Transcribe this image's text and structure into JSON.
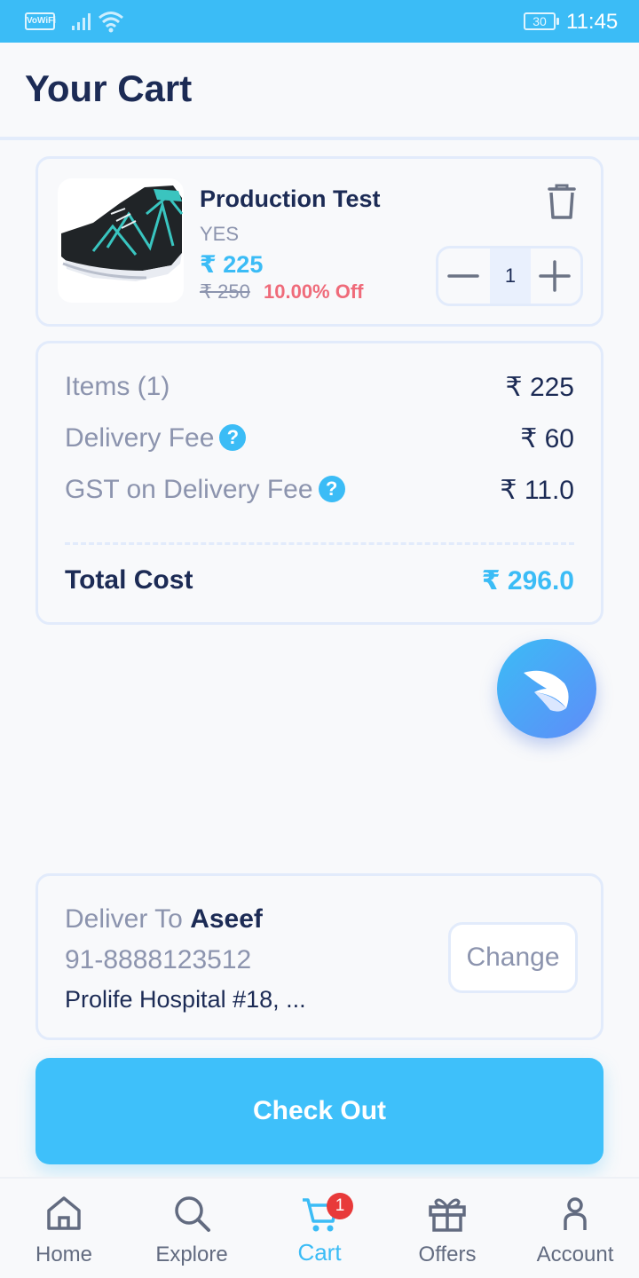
{
  "status_bar": {
    "carrier_badge": "VoWiFi",
    "battery": "30",
    "time": "11:45"
  },
  "header": {
    "title": "Your Cart"
  },
  "cart_item": {
    "name": "Production Test",
    "variant": "YES",
    "price": "₹ 225",
    "original_price": "₹ 250",
    "discount": "10.00% Off",
    "quantity": "1"
  },
  "summary": {
    "rows": [
      {
        "label": "Items (1)",
        "value": "₹ 225",
        "help": false
      },
      {
        "label": "Delivery Fee",
        "value": "₹ 60",
        "help": true
      },
      {
        "label": "GST on Delivery Fee",
        "value": "₹ 11.0",
        "help": true
      }
    ],
    "help_glyph": "?",
    "total_label": "Total Cost",
    "total_value": "₹ 296.0"
  },
  "address": {
    "prefix": "Deliver To",
    "name": "Aseef",
    "phone": "91-8888123512",
    "line": "Prolife Hospital #18, ...",
    "change_label": "Change"
  },
  "checkout": {
    "label": "Check Out"
  },
  "nav": {
    "items": [
      {
        "label": "Home",
        "icon": "home-icon"
      },
      {
        "label": "Explore",
        "icon": "search-icon"
      },
      {
        "label": "Cart",
        "icon": "cart-icon",
        "badge": "1",
        "active": true
      },
      {
        "label": "Offers",
        "icon": "gift-icon"
      },
      {
        "label": "Account",
        "icon": "account-icon"
      }
    ]
  },
  "colors": {
    "accent": "#3bbcf6",
    "discount": "#ef6b7a",
    "badge": "#e83a3a",
    "text_dark": "#1c2b55",
    "text_muted": "#8c94ae"
  }
}
